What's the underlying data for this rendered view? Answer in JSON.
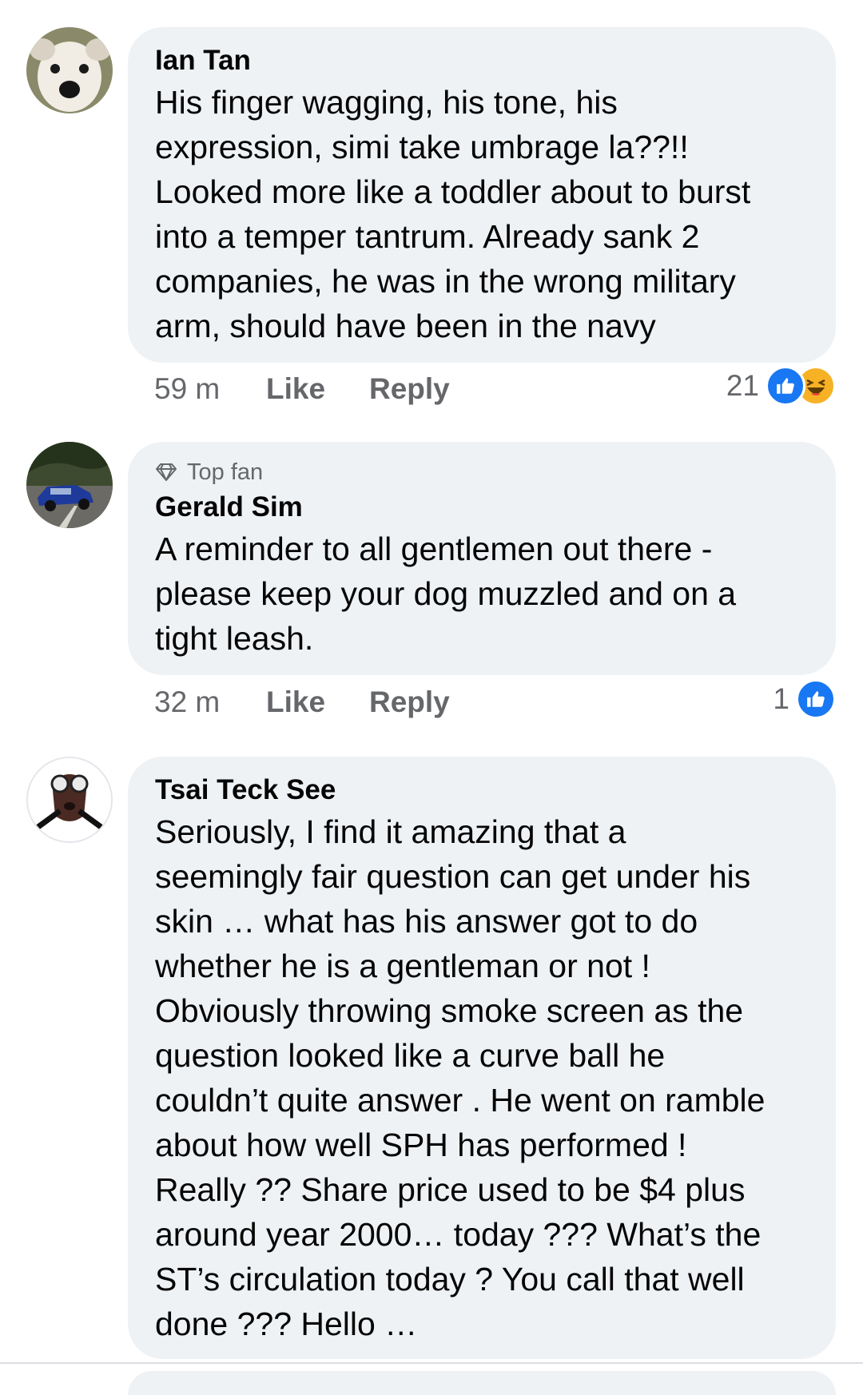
{
  "comments": [
    {
      "author": "Ian Tan",
      "badge": "",
      "text": "His finger wagging, his tone, his\nexpression, simi take umbrage la??!!\nLooked more like a toddler about to burst\ninto a temper tantrum. Already sank 2\ncompanies, he was in the wrong military\narm, should have been in the navy",
      "time": "59 m",
      "like_label": "Like",
      "reply_label": "Reply",
      "reaction_count": "21",
      "reactions": [
        "like-icon",
        "haha-icon"
      ]
    },
    {
      "author": "Gerald Sim",
      "badge": "Top fan",
      "text": "A reminder to all gentlemen out there -\nplease keep your dog muzzled and on a\ntight leash.",
      "time": "32 m",
      "like_label": "Like",
      "reply_label": "Reply",
      "reaction_count": "1",
      "reactions": [
        "like-icon"
      ]
    },
    {
      "author": "Tsai Teck See",
      "badge": "",
      "text": "Seriously, I find it amazing that a\nseemingly fair question can get under his\nskin … what has his answer got to do\nwhether he is a gentleman or not !\nObviously throwing smoke screen as the\nquestion looked like a curve ball he\ncouldn’t quite answer . He went on ramble\nabout how well SPH has performed !\nReally ?? Share price used to be $4 plus\naround year 2000… today ??? What’s the\nST’s circulation today ?  You call that well\ndone ??? Hello …"
    }
  ],
  "colors": {
    "bubble": "#eff2f5",
    "secondary_text": "#65676b",
    "like_blue": "#1877f2",
    "haha_yellow": "#f7b125"
  }
}
